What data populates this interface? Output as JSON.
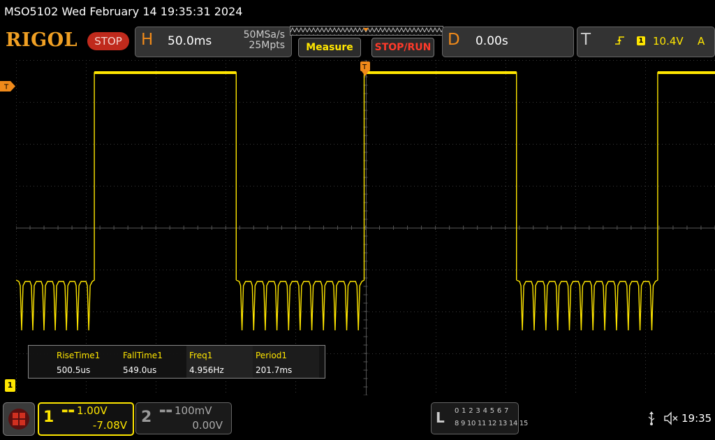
{
  "title": "MSO5102  Wed February 14 19:35:31 2024",
  "brand": {
    "logo": "RIGOL",
    "run_state": "STOP"
  },
  "horizontal": {
    "letter": "H",
    "timebase": "50.0ms",
    "sample_rate": "50MSa/s",
    "memory_depth": "25Mpts"
  },
  "buttons": {
    "measure": "Measure",
    "stop_run": "STOP/RUN"
  },
  "delay": {
    "letter": "D",
    "value": "0.00s"
  },
  "trigger": {
    "letter": "T",
    "edge_icon": "rising-edge-icon",
    "source_badge": "1",
    "level": "10.4V",
    "mode": "A"
  },
  "markers": {
    "trigger_level": "T",
    "ch1_ground": "1"
  },
  "measurements": [
    {
      "label": "RiseTime1",
      "value": "500.5us"
    },
    {
      "label": "FallTime1",
      "value": "549.0us"
    },
    {
      "label": "Freq1",
      "value": "4.956Hz"
    },
    {
      "label": "Period1",
      "value": "201.7ms"
    }
  ],
  "channels": {
    "ch1": {
      "number": "1",
      "coupling": "DC",
      "scale": "1.00V",
      "offset": "-7.08V",
      "color": "#ffe600"
    },
    "ch2": {
      "number": "2",
      "coupling": "DC",
      "scale": "100mV",
      "offset": "0.00V"
    }
  },
  "logic": {
    "letter": "L",
    "row1": "0 1 2 3  4 5 6 7",
    "row2": "8 9 10 11 12 13 14 15"
  },
  "status": {
    "time": "19:35",
    "usb_icon": "usb-icon",
    "sound_icon": "speaker-muted-icon"
  },
  "waveform": {
    "high_segments": [
      [
        0.112,
        0.315
      ],
      [
        0.498,
        0.716
      ],
      [
        0.918,
        1.0
      ]
    ],
    "notches_per_low_segment": [
      7,
      11,
      12
    ]
  }
}
